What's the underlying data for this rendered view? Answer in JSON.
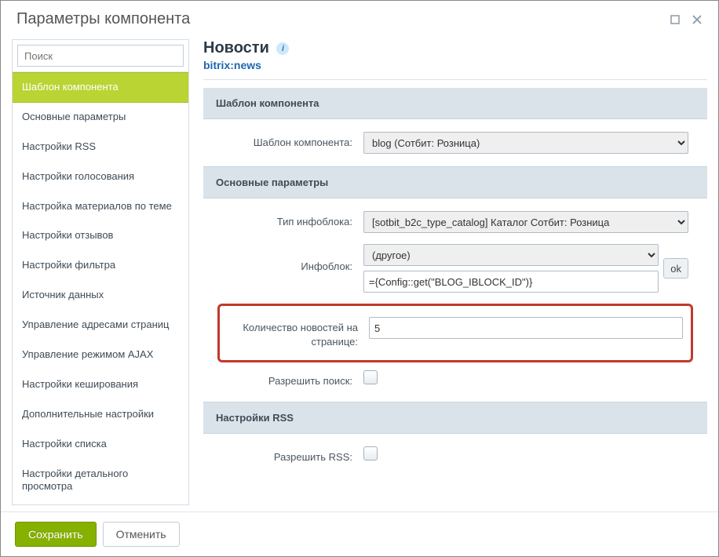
{
  "dialog": {
    "title": "Параметры компонента"
  },
  "search": {
    "placeholder": "Поиск"
  },
  "sidebar": {
    "items": [
      "Шаблон компонента",
      "Основные параметры",
      "Настройки RSS",
      "Настройки голосования",
      "Настройка материалов по теме",
      "Настройки отзывов",
      "Настройки фильтра",
      "Источник данных",
      "Управление адресами страниц",
      "Управление режимом AJAX",
      "Настройки кеширования",
      "Дополнительные настройки",
      "Настройки списка",
      "Настройки детального просмотра"
    ]
  },
  "component": {
    "title": "Новости",
    "code": "bitrix:news"
  },
  "sections": {
    "template": {
      "header": "Шаблон компонента",
      "template_label": "Шаблон компонента:",
      "template_value": "blog (Сотбит: Розница)"
    },
    "main": {
      "header": "Основные параметры",
      "iblock_type_label": "Тип инфоблока:",
      "iblock_type_value": "[sotbit_b2c_type_catalog] Каталог Сотбит: Розница",
      "iblock_label": "Инфоблок:",
      "iblock_select_value": "(другое)",
      "iblock_text_value": "={Config::get(\"BLOG_IBLOCK_ID\")}",
      "ok_label": "ok",
      "count_label": "Количество новостей на странице:",
      "count_value": "5",
      "search_label": "Разрешить поиск:"
    },
    "rss": {
      "header": "Настройки RSS",
      "allow_label": "Разрешить RSS:"
    }
  },
  "footer": {
    "save": "Сохранить",
    "cancel": "Отменить"
  }
}
